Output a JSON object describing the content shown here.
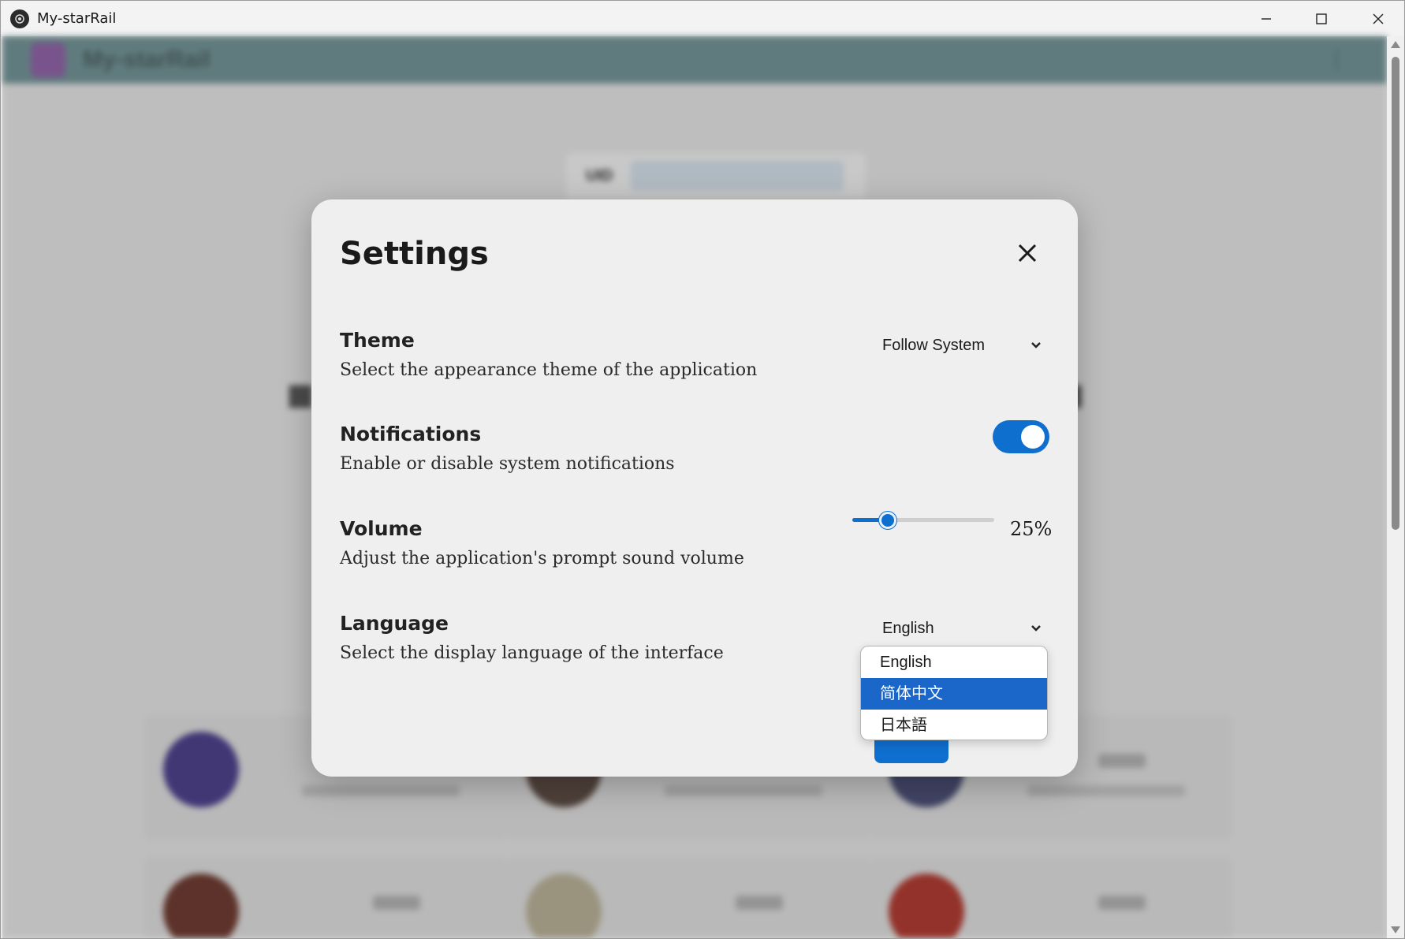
{
  "window": {
    "title": "My-starRail"
  },
  "background_app": {
    "header_name": "My-starRail",
    "uid_label": "UID"
  },
  "settings": {
    "title": "Settings",
    "theme": {
      "title": "Theme",
      "description": "Select the appearance theme of the application",
      "value": "Follow System"
    },
    "notifications": {
      "title": "Notifications",
      "description": "Enable or disable system notifications",
      "enabled": true
    },
    "volume": {
      "title": "Volume",
      "description": "Adjust the application's prompt sound volume",
      "value_label": "25%",
      "level": 0.25
    },
    "language": {
      "title": "Language",
      "description": "Select the display language of the interface",
      "value": "English",
      "options": [
        "English",
        "简体中文",
        "日本語"
      ],
      "highlighted_option": "简体中文"
    }
  },
  "colors": {
    "accent": "#0f6fcf",
    "dropdown_highlight": "#1a66c9",
    "dialog_bg": "#efefef"
  },
  "icons": {
    "app": "app-logo-icon",
    "close": "close-icon",
    "chevron": "chevron-down-icon"
  }
}
